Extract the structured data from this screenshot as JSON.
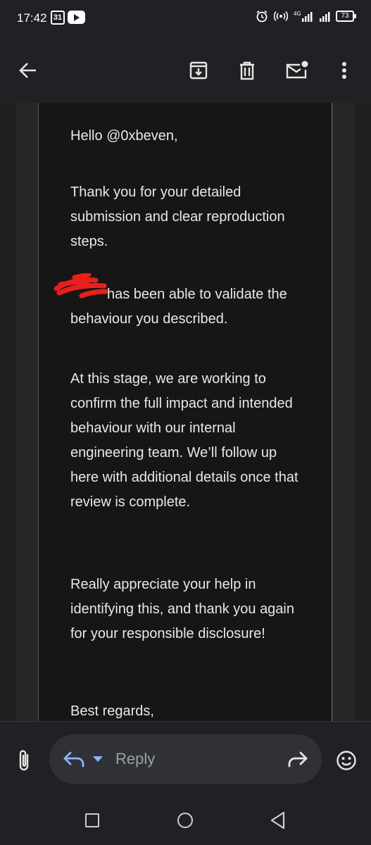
{
  "status_bar": {
    "time": "17:42",
    "calendar_day": "31",
    "battery": "73"
  },
  "app_bar": {
    "icons": [
      "back-arrow-icon",
      "archive-icon",
      "delete-icon",
      "mark-unread-icon",
      "more-vert-icon"
    ]
  },
  "email": {
    "greeting": "Hello @0xbeven,",
    "paragraph_1": "Thank you for your detailed submission and clear reproduction steps.",
    "paragraph_2": "has been able to validate the behaviour you described.",
    "paragraph_3": "At this stage, we are working to confirm the full impact and intended behaviour with our internal engineering team. We’ll follow up here with additional details once that review is complete.",
    "paragraph_4": "Really appreciate your help in identifying this, and thank you again for your responsible disclosure!",
    "sign_off": "Best regards,"
  },
  "reply_bar": {
    "reply_placeholder": "Reply"
  },
  "colors": {
    "background": "#1f1f1f",
    "message_bg": "#161616",
    "redaction": "#e8201c",
    "reply_accent": "#8ab4f8"
  }
}
